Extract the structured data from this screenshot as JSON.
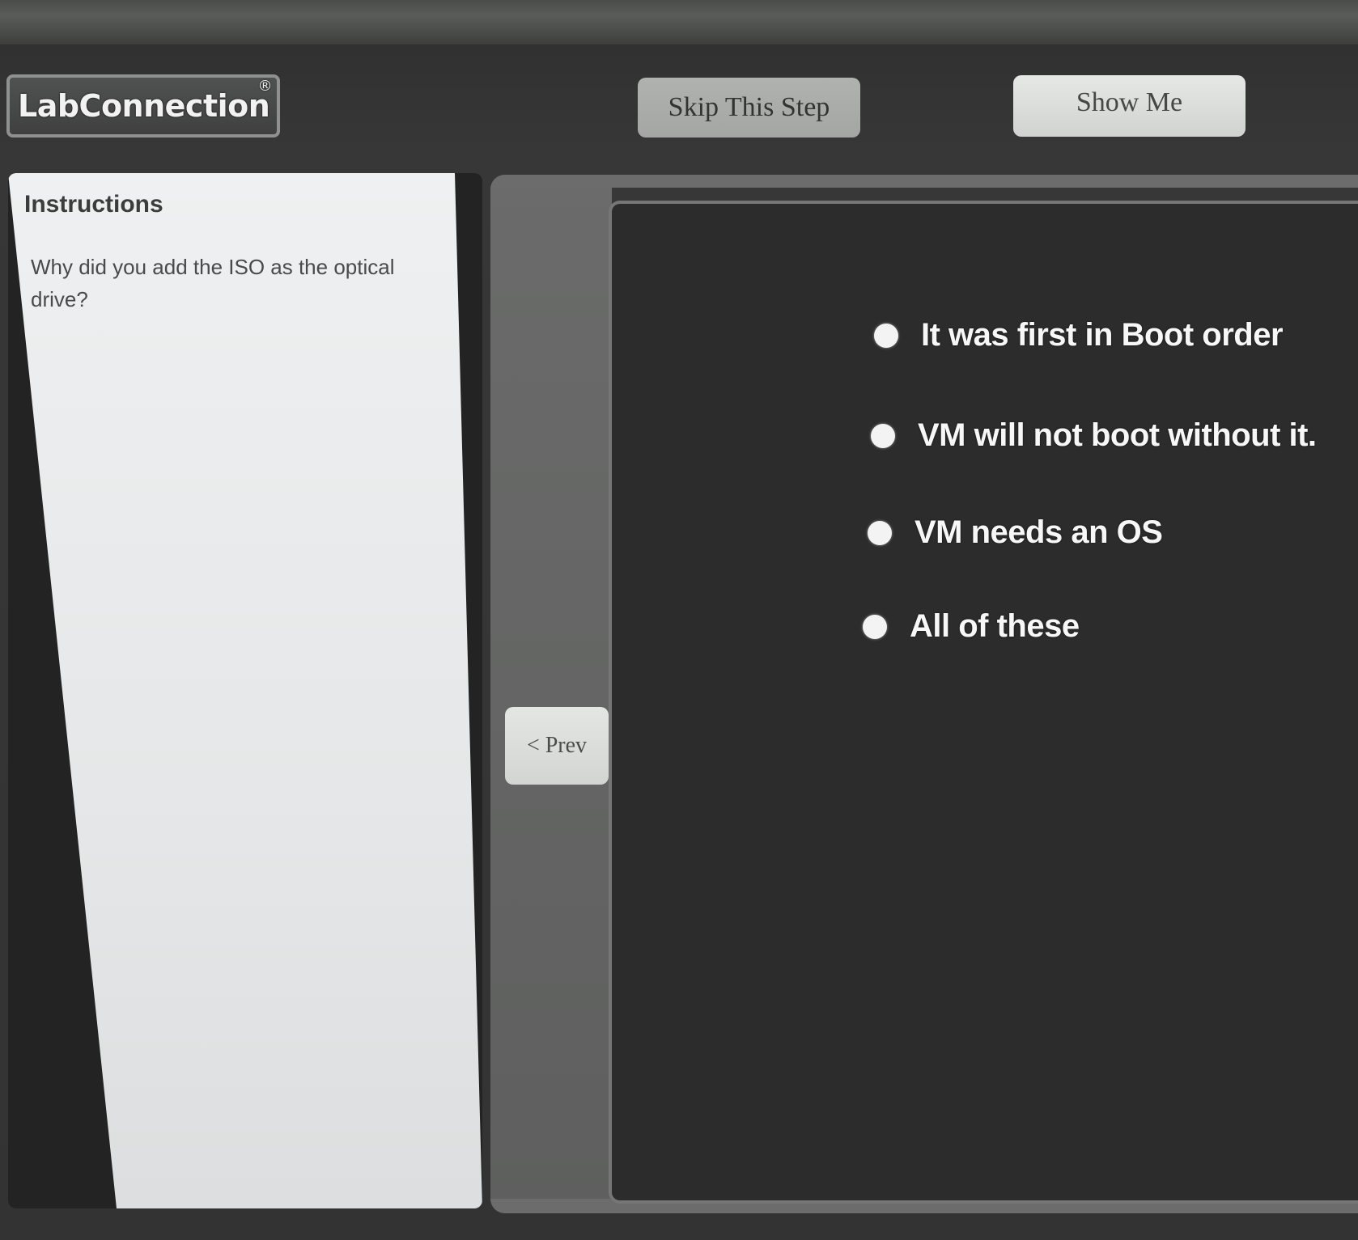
{
  "header": {
    "logo_text": "LabConnection",
    "logo_mark": "®",
    "skip_label": "Skip This Step",
    "show_label": "Show Me"
  },
  "instructions": {
    "title": "Instructions",
    "question": "Why did you add the ISO as the optical drive?"
  },
  "navigation": {
    "prev_label": "< Prev"
  },
  "options": [
    "It was first in Boot order",
    "VM will not boot without it.",
    "VM needs an OS",
    "All of these"
  ],
  "colors": {
    "background": "#333333",
    "panel_light": "#e5e7e8",
    "answer_panel": "#2c2c2c",
    "button": "#d3d5d3"
  }
}
